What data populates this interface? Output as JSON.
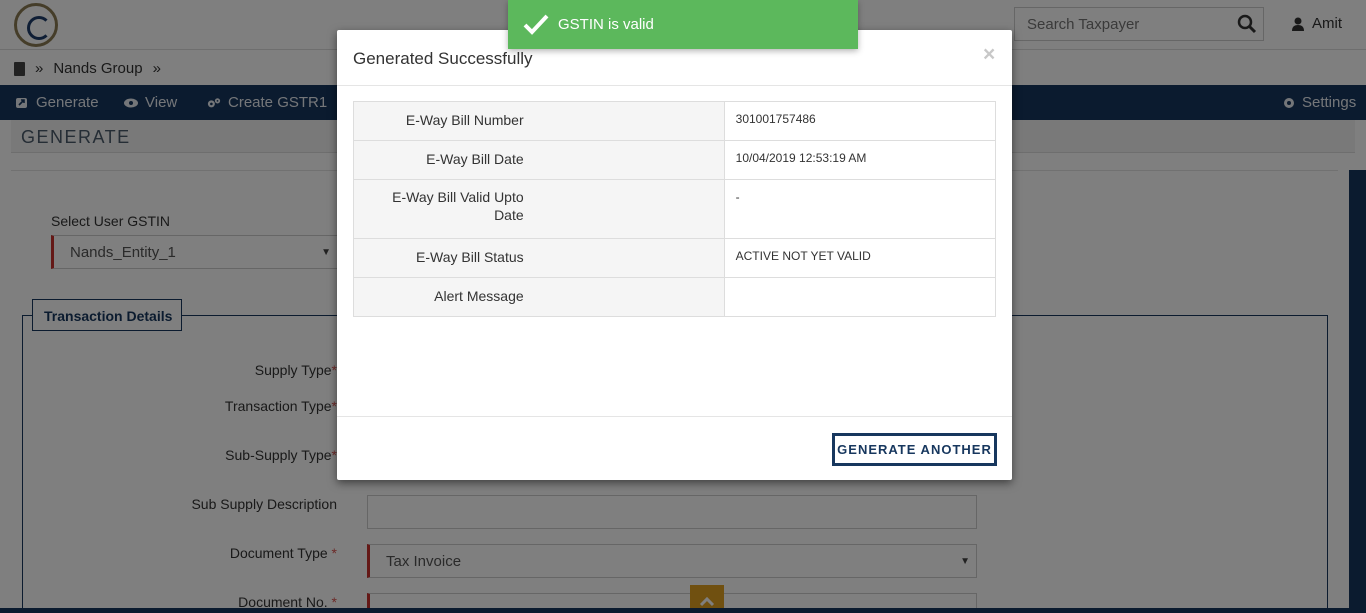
{
  "header": {
    "search_placeholder": "Search Taxpayer",
    "user_name": "Amit"
  },
  "breadcrumb": {
    "separator": "»",
    "items": [
      "Nands Group"
    ]
  },
  "nav": {
    "items": [
      {
        "label": "Generate",
        "icon": "share-square-icon"
      },
      {
        "label": "View",
        "icon": "eye-icon"
      },
      {
        "label": "Create GSTR1",
        "icon": "cogs-icon"
      }
    ],
    "settings_label": "Settings"
  },
  "page": {
    "title": "GENERATE",
    "user_gstin_label": "Select User GSTIN",
    "user_gstin_value": "Nands_Entity_1",
    "transaction_legend": "Transaction Details",
    "fields": {
      "supply_type": "Supply Type",
      "transaction_type": "Transaction Type",
      "sub_supply_type": "Sub-Supply Type",
      "sub_supply_description": "Sub Supply Description",
      "document_type": "Document Type",
      "document_type_value": "Tax Invoice",
      "document_no": "Document No."
    },
    "required_mark": "*"
  },
  "modal": {
    "title": "Generated Successfully",
    "close": "×",
    "rows": [
      {
        "key": "E-Way Bill Number",
        "value": "301001757486"
      },
      {
        "key": "E-Way Bill Date",
        "value": "10/04/2019 12:53:19 AM"
      },
      {
        "key": "E-Way Bill Valid Upto Date",
        "value": "-"
      },
      {
        "key": "E-Way Bill Status",
        "value": "ACTIVE NOT YET VALID"
      },
      {
        "key": "Alert Message",
        "value": ""
      }
    ],
    "button": "GENERATE ANOTHER"
  },
  "toast": {
    "message": "GSTIN is valid"
  },
  "colors": {
    "navy": "#17375e",
    "success": "#5cb85c",
    "required": "#c9302c"
  }
}
